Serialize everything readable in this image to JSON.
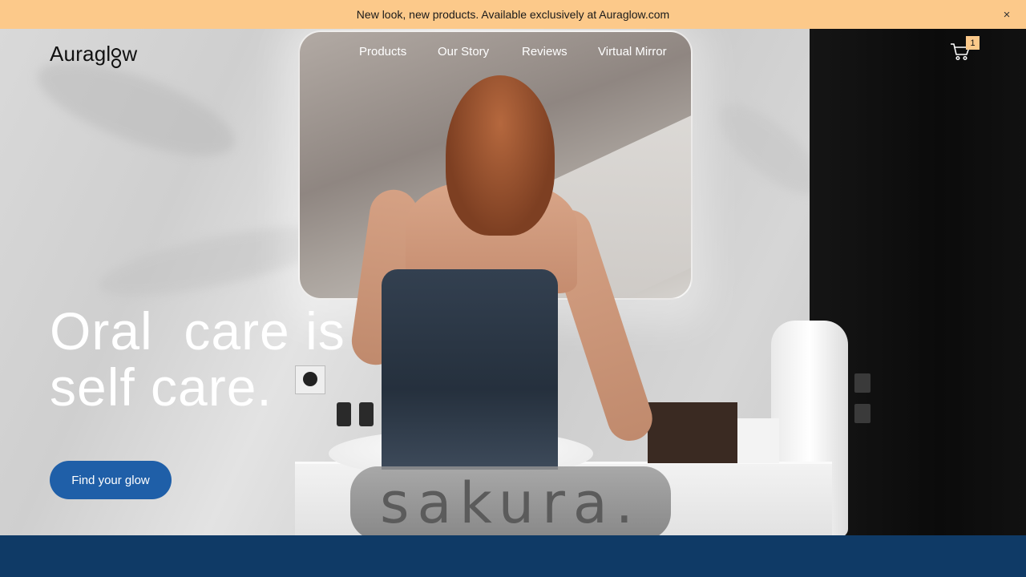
{
  "announcement": {
    "text": "New look, new products. Available exclusively at Auraglow.com",
    "close_label": "×"
  },
  "header": {
    "logo_text": "Auragl",
    "nav": [
      {
        "label": "Products"
      },
      {
        "label": "Our Story"
      },
      {
        "label": "Reviews"
      },
      {
        "label": "Virtual Mirror"
      }
    ],
    "cart": {
      "icon": "cart-icon",
      "count": "1"
    }
  },
  "hero": {
    "headline_line1": "Oral  care is",
    "headline_line2": "self care.",
    "cta_label": "Find your glow",
    "product_label": "sakura."
  },
  "colors": {
    "announcement_bg": "#fcc98a",
    "cta_bg": "#1f5fa8",
    "bottom_band": "#0f3a66"
  }
}
